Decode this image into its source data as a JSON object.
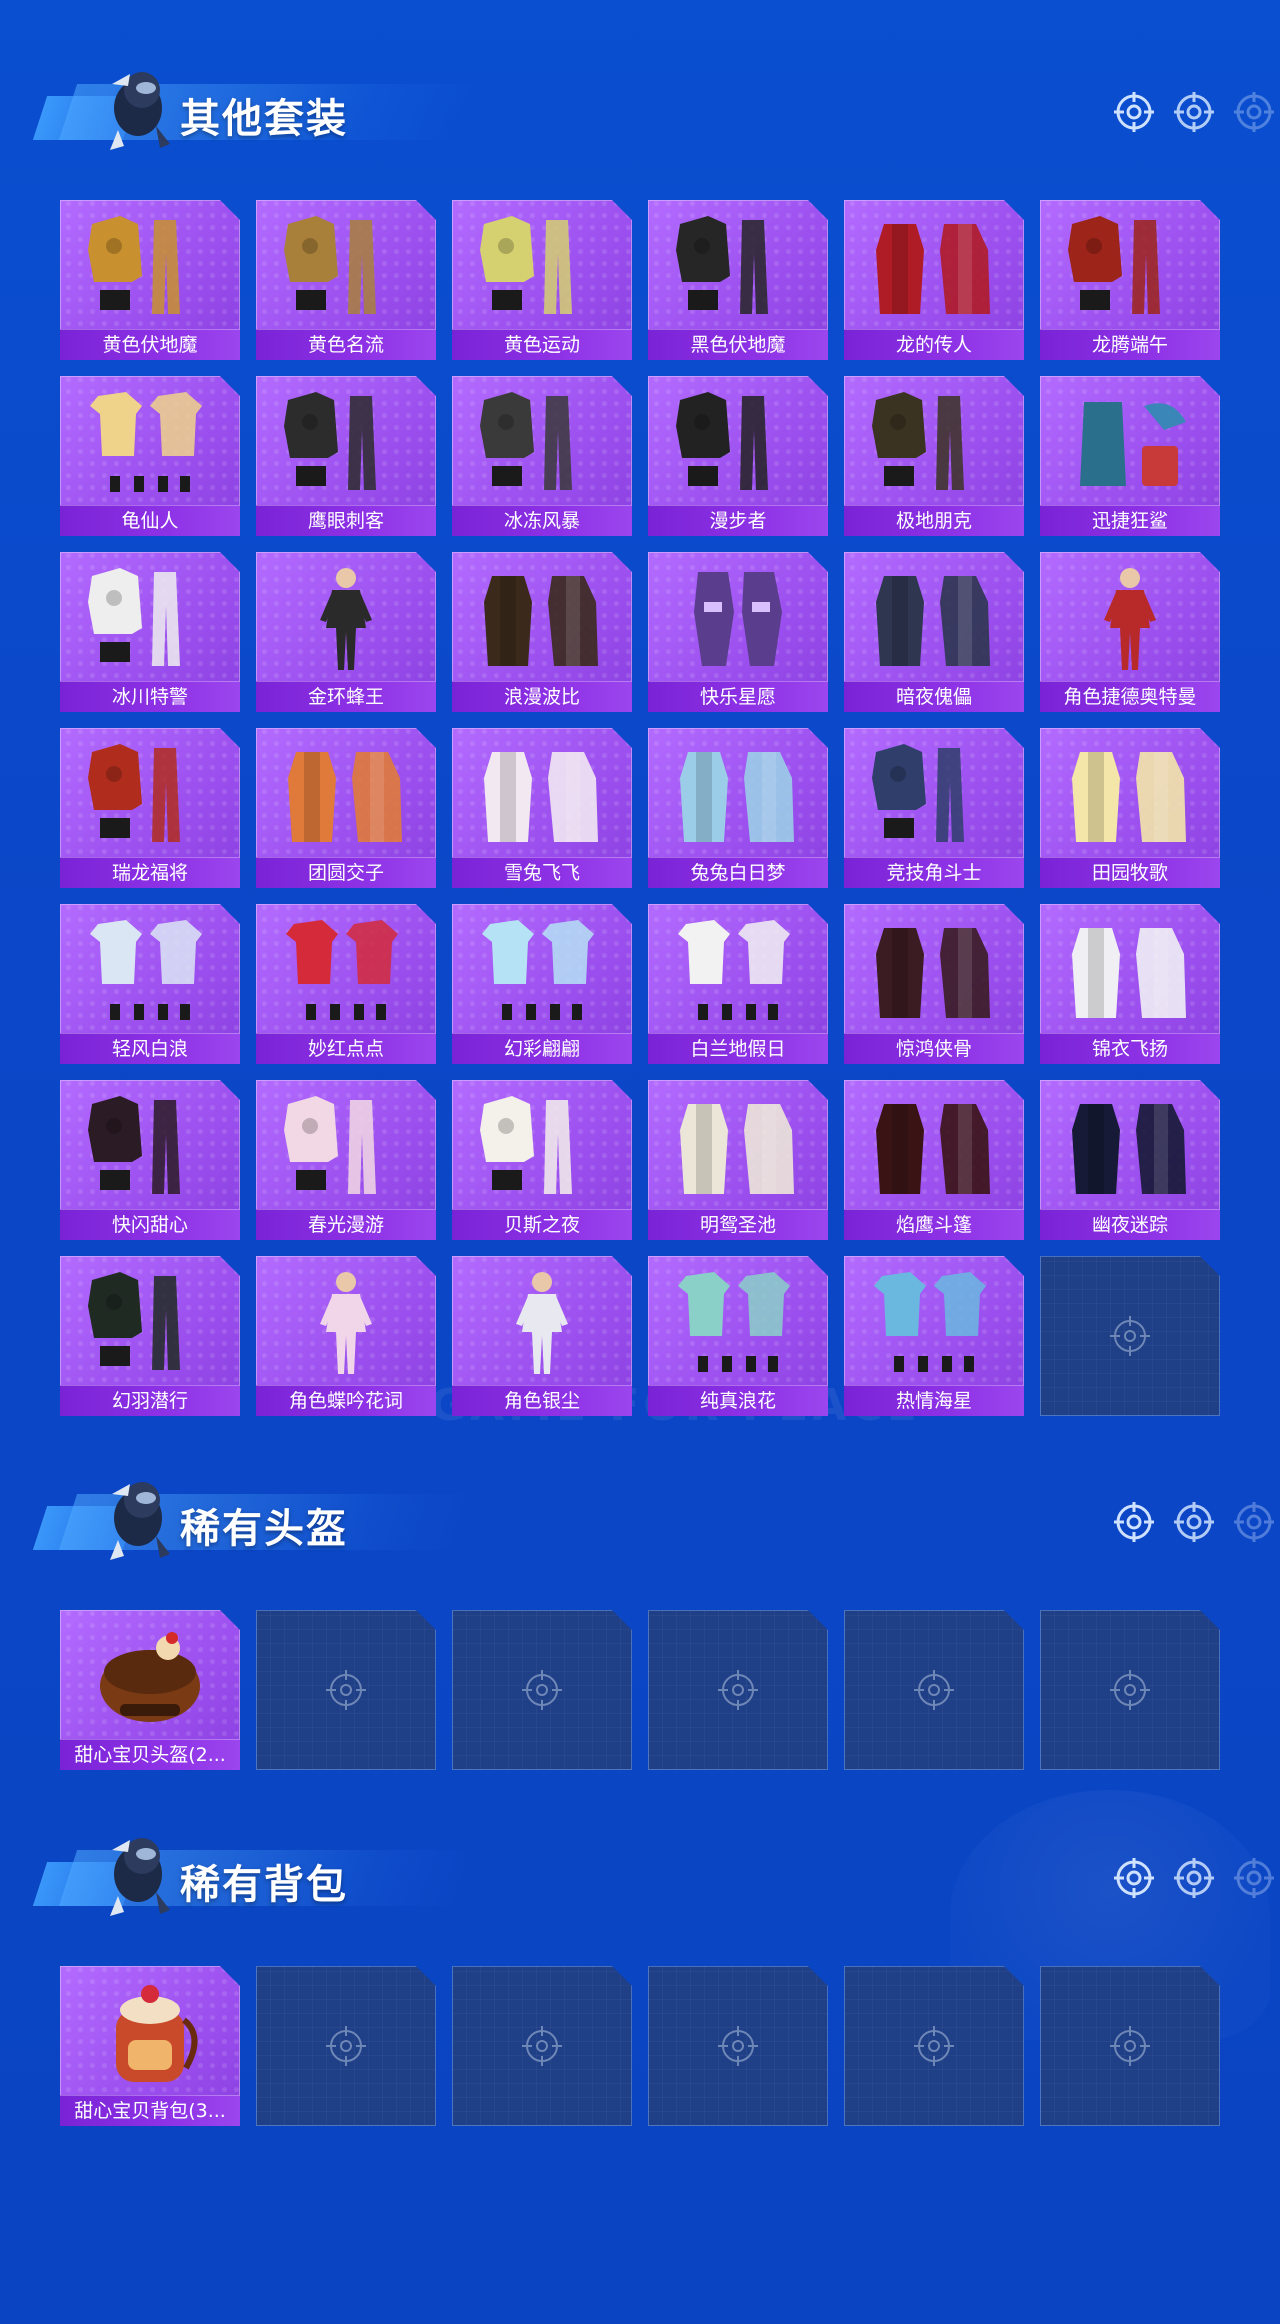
{
  "sections": [
    {
      "title": "其他套装",
      "items": [
        {
          "label": "黄色伏地魔",
          "icon": "hoodie-outfit-icon",
          "color": "#c8902e"
        },
        {
          "label": "黄色名流",
          "icon": "suit-outfit-icon",
          "color": "#a9803a"
        },
        {
          "label": "黄色运动",
          "icon": "jacket-outfit-icon",
          "color": "#d5d070"
        },
        {
          "label": "黑色伏地魔",
          "icon": "hoodie-outfit-icon",
          "color": "#262626"
        },
        {
          "label": "龙的传人",
          "icon": "dress-outfit-icon",
          "color": "#b01c26"
        },
        {
          "label": "龙腾端午",
          "icon": "jacket-outfit-icon",
          "color": "#9c2418"
        },
        {
          "label": "龟仙人",
          "icon": "shirt-outfit-icon",
          "color": "#f0d38a"
        },
        {
          "label": "鹰眼刺客",
          "icon": "armor-outfit-icon",
          "color": "#2c2c2c"
        },
        {
          "label": "冰冻风暴",
          "icon": "armor-outfit-icon",
          "color": "#3a3a3a"
        },
        {
          "label": "漫步者",
          "icon": "armor-outfit-icon",
          "color": "#222222"
        },
        {
          "label": "极地朋克",
          "icon": "armor-outfit-icon",
          "color": "#3b3322"
        },
        {
          "label": "迅捷狂鲨",
          "icon": "shark-outfit-icon",
          "color": "#2a6f8c"
        },
        {
          "label": "冰川特警",
          "icon": "jacket-outfit-icon",
          "color": "#eeeeee"
        },
        {
          "label": "金环蜂王",
          "icon": "figure-outfit-icon",
          "color": "#2a2a2a"
        },
        {
          "label": "浪漫波比",
          "icon": "dress-outfit-icon",
          "color": "#3b2a1c"
        },
        {
          "label": "快乐星愿",
          "icon": "mecha-outfit-icon",
          "color": "#5a3d8c"
        },
        {
          "label": "暗夜傀儡",
          "icon": "dress-outfit-icon",
          "color": "#2e3650"
        },
        {
          "label": "角色捷德奥特曼",
          "icon": "figure-outfit-icon",
          "color": "#b82a2a"
        },
        {
          "label": "瑞龙福将",
          "icon": "armor-outfit-icon",
          "color": "#b02d1e"
        },
        {
          "label": "团圆交子",
          "icon": "dress-outfit-icon",
          "color": "#e07a3a"
        },
        {
          "label": "雪兔飞飞",
          "icon": "dress-outfit-icon",
          "color": "#f2e8f2"
        },
        {
          "label": "兔兔白日梦",
          "icon": "dress-outfit-icon",
          "color": "#9bcde8"
        },
        {
          "label": "竞技角斗士",
          "icon": "armor-outfit-icon",
          "color": "#2f3e6b"
        },
        {
          "label": "田园牧歌",
          "icon": "dress-outfit-icon",
          "color": "#f3e6a8"
        },
        {
          "label": "轻风白浪",
          "icon": "shirt-outfit-icon",
          "color": "#dbe6f5"
        },
        {
          "label": "妙红点点",
          "icon": "shirt-outfit-icon",
          "color": "#d42a3a"
        },
        {
          "label": "幻彩翩翩",
          "icon": "shirt-outfit-icon",
          "color": "#b5e2f5"
        },
        {
          "label": "白兰地假日",
          "icon": "shirt-outfit-icon",
          "color": "#f2f2f2"
        },
        {
          "label": "惊鸿侠骨",
          "icon": "robe-outfit-icon",
          "color": "#3a1c22"
        },
        {
          "label": "锦衣飞扬",
          "icon": "robe-outfit-icon",
          "color": "#f0f0f4"
        },
        {
          "label": "快闪甜心",
          "icon": "jacket-outfit-icon",
          "color": "#2b1b24"
        },
        {
          "label": "春光漫游",
          "icon": "jacket-outfit-icon",
          "color": "#f2d8e4"
        },
        {
          "label": "贝斯之夜",
          "icon": "jacket-outfit-icon",
          "color": "#f4f0ea"
        },
        {
          "label": "明鸳圣池",
          "icon": "dress-outfit-icon",
          "color": "#ece6d8"
        },
        {
          "label": "焰鹰斗篷",
          "icon": "cloak-outfit-icon",
          "color": "#3a1414"
        },
        {
          "label": "幽夜迷踪",
          "icon": "cloak-outfit-icon",
          "color": "#161a36"
        },
        {
          "label": "幻羽潜行",
          "icon": "armor-outfit-icon",
          "color": "#1e2a22"
        },
        {
          "label": "角色蝶吟花词",
          "icon": "figure-outfit-icon",
          "color": "#f0d6e8"
        },
        {
          "label": "角色银尘",
          "icon": "figure-outfit-icon",
          "color": "#e8e8f0"
        },
        {
          "label": "纯真浪花",
          "icon": "shirt-outfit-icon",
          "color": "#8ad0c8"
        },
        {
          "label": "热情海星",
          "icon": "shirt-outfit-icon",
          "color": "#6ab8e0"
        },
        {
          "label": "",
          "icon": "empty-slot-icon",
          "color": ""
        }
      ]
    },
    {
      "title": "稀有头盔",
      "items": [
        {
          "label": "甜心宝贝头盔(2...",
          "icon": "helmet-icon",
          "color": "#7a3a14"
        },
        {
          "label": "",
          "icon": "empty-slot-icon",
          "color": ""
        },
        {
          "label": "",
          "icon": "empty-slot-icon",
          "color": ""
        },
        {
          "label": "",
          "icon": "empty-slot-icon",
          "color": ""
        },
        {
          "label": "",
          "icon": "empty-slot-icon",
          "color": ""
        },
        {
          "label": "",
          "icon": "empty-slot-icon",
          "color": ""
        }
      ]
    },
    {
      "title": "稀有背包",
      "items": [
        {
          "label": "甜心宝贝背包(3...",
          "icon": "backpack-icon",
          "color": "#c84a2a"
        },
        {
          "label": "",
          "icon": "empty-slot-icon",
          "color": ""
        },
        {
          "label": "",
          "icon": "empty-slot-icon",
          "color": ""
        },
        {
          "label": "",
          "icon": "empty-slot-icon",
          "color": ""
        },
        {
          "label": "",
          "icon": "empty-slot-icon",
          "color": ""
        },
        {
          "label": "",
          "icon": "empty-slot-icon",
          "color": ""
        }
      ]
    }
  ],
  "watermark": "GAME FOR PEACE",
  "colors": {
    "background": "#0b4bcc",
    "card_fill": "#a35cf5",
    "label_bar": "#8230de",
    "empty_card": "#1f3f86"
  }
}
